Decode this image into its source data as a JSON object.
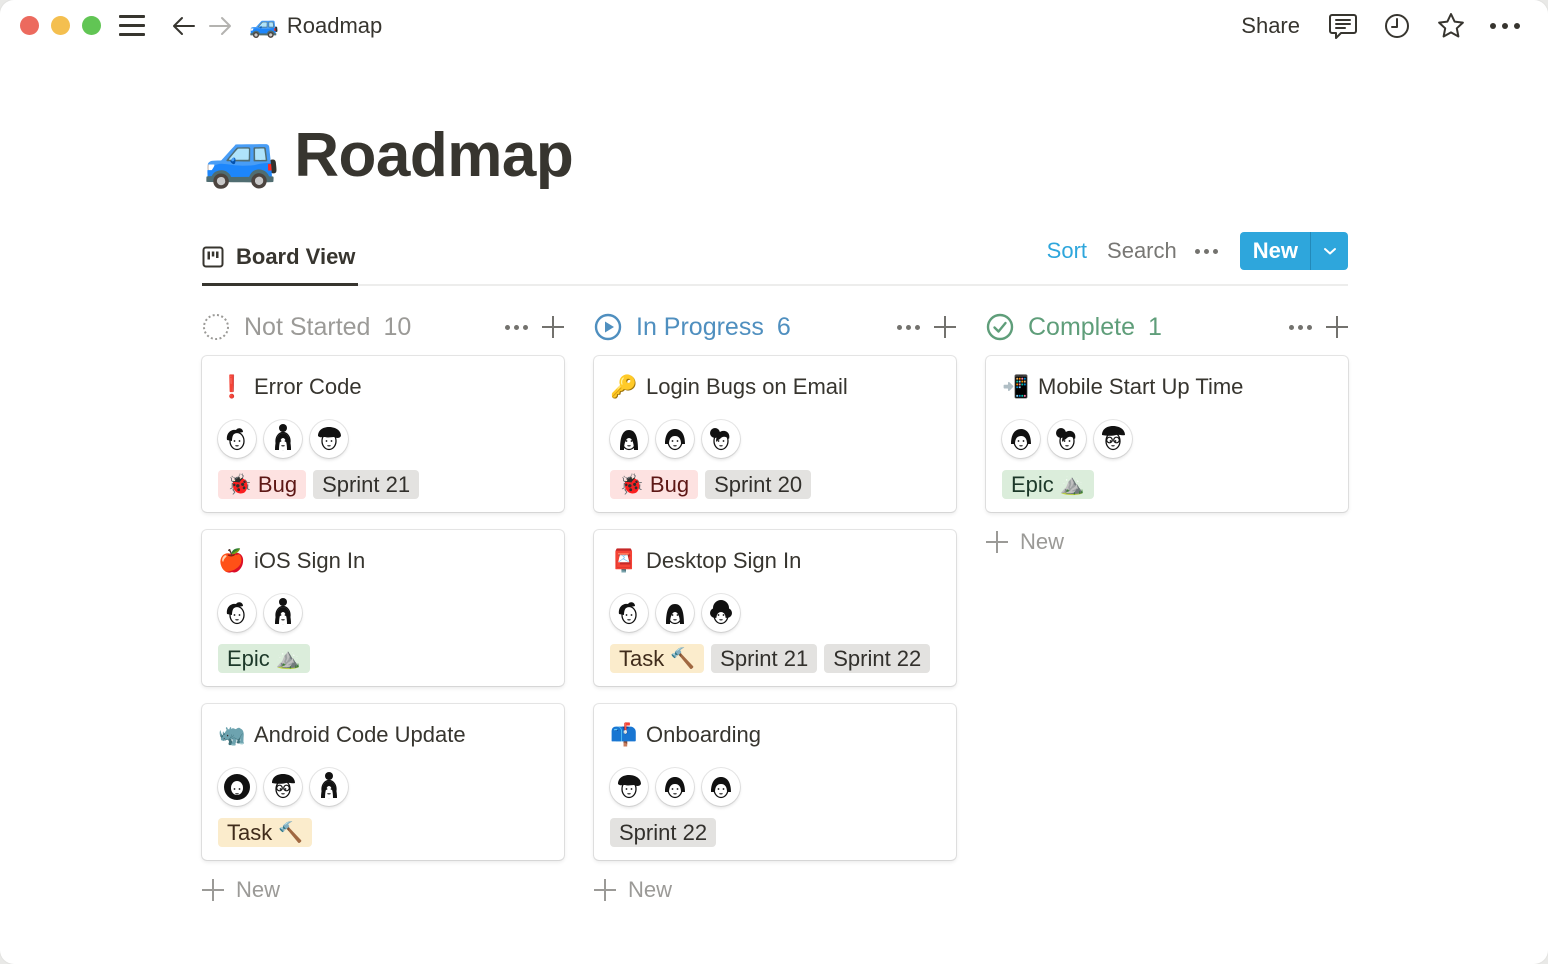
{
  "window": {
    "breadcrumb": {
      "emoji": "🚙",
      "label": "Roadmap"
    },
    "top_actions": {
      "share_label": "Share"
    }
  },
  "page": {
    "emoji": "🚙",
    "title": "Roadmap"
  },
  "view": {
    "tab_label": "Board View",
    "sort_label": "Sort",
    "search_label": "Search",
    "new_label": "New"
  },
  "colors": {
    "accent": "#2ea6dc",
    "not_started": "#9b9a97",
    "in_progress": "#4f8fbf",
    "complete": "#5f9e7a"
  },
  "columns": [
    {
      "name": "Not Started",
      "count": "10",
      "status_icon": "dotted-circle-icon",
      "add_label": "New",
      "cards": [
        {
          "emoji": "❗",
          "title": "Error Code",
          "avatars": [
            "avatar-man-side",
            "avatar-woman-bun",
            "avatar-woman-curly"
          ],
          "tags": [
            {
              "type": "bug",
              "label": "Bug",
              "emoji": "🐞"
            },
            {
              "type": "sprint",
              "label": "Sprint 21"
            }
          ]
        },
        {
          "emoji": "🍎",
          "title": "iOS Sign In",
          "avatars": [
            "avatar-man-side",
            "avatar-woman-bun"
          ],
          "tags": [
            {
              "type": "epic",
              "label": "Epic",
              "emoji": "⛰️"
            }
          ]
        },
        {
          "emoji": "🦏",
          "title": "Android Code Update",
          "avatars": [
            "avatar-afro",
            "avatar-glasses-curly",
            "avatar-woman-bun"
          ],
          "tags": [
            {
              "type": "task",
              "label": "Task",
              "emoji": "🔨"
            }
          ]
        }
      ]
    },
    {
      "name": "In Progress",
      "count": "6",
      "status_icon": "play-circle-icon",
      "add_label": "New",
      "cards": [
        {
          "emoji": "🔑",
          "title": "Login Bugs on Email",
          "avatars": [
            "avatar-woman-long",
            "avatar-woman-bob",
            "avatar-woman-ponytail"
          ],
          "tags": [
            {
              "type": "bug",
              "label": "Bug",
              "emoji": "🐞"
            },
            {
              "type": "sprint",
              "label": "Sprint 20"
            }
          ]
        },
        {
          "emoji": "📮",
          "title": "Desktop Sign In",
          "avatars": [
            "avatar-man-side",
            "avatar-woman-long",
            "avatar-woman-curly-dark"
          ],
          "tags": [
            {
              "type": "task",
              "label": "Task",
              "emoji": "🔨"
            },
            {
              "type": "sprint",
              "label": "Sprint 21"
            },
            {
              "type": "sprint",
              "label": "Sprint 22"
            }
          ]
        },
        {
          "emoji": "📫",
          "title": "Onboarding",
          "avatars": [
            "avatar-woman-curly",
            "avatar-woman-bob",
            "avatar-woman-bob"
          ],
          "tags": [
            {
              "type": "sprint",
              "label": "Sprint 22"
            }
          ]
        }
      ]
    },
    {
      "name": "Complete",
      "count": "1",
      "status_icon": "check-circle-icon",
      "add_label": "New",
      "cards": [
        {
          "emoji": "📲",
          "title": "Mobile Start Up Time",
          "avatars": [
            "avatar-woman-bob",
            "avatar-woman-ponytail",
            "avatar-glasses-curly"
          ],
          "tags": [
            {
              "type": "epic",
              "label": "Epic",
              "emoji": "⛰️"
            }
          ]
        }
      ]
    }
  ]
}
